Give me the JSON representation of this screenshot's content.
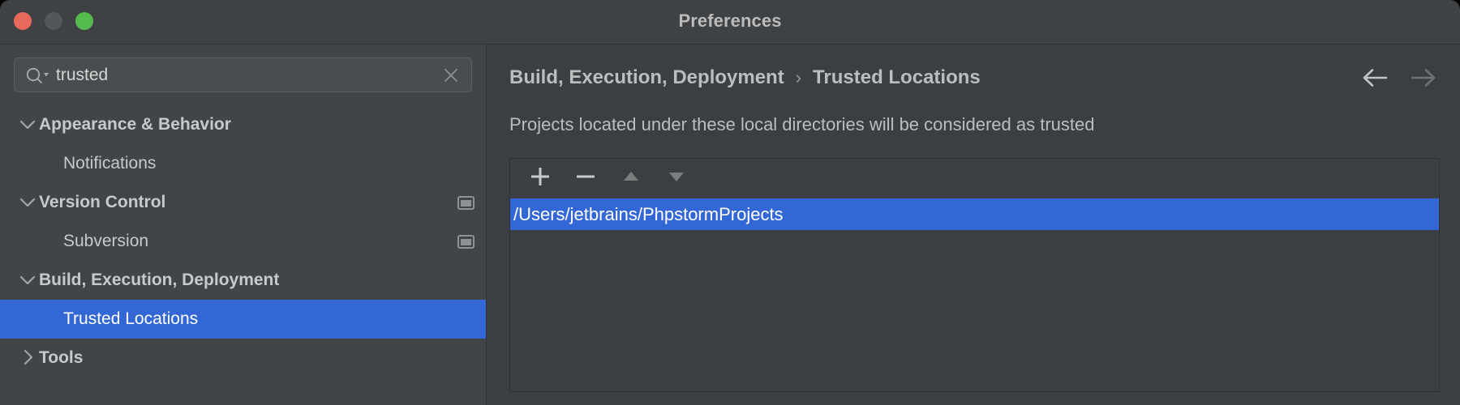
{
  "window": {
    "title": "Preferences",
    "controls": [
      {
        "name": "close",
        "color": "#e8695c"
      },
      {
        "name": "minimize",
        "color": "#53565a"
      },
      {
        "name": "zoom",
        "color": "#54bb4e"
      }
    ]
  },
  "search": {
    "value": "trusted",
    "placeholder": "Search",
    "search_icon": "search-icon",
    "clear_icon": "close-icon"
  },
  "sidebar": {
    "items": [
      {
        "label": "Appearance & Behavior",
        "type": "group",
        "expanded": true,
        "chevron": "chevron-down-icon",
        "selected": false,
        "badge": false
      },
      {
        "label": "Notifications",
        "type": "child",
        "selected": false,
        "badge": false
      },
      {
        "label": "Version Control",
        "type": "group",
        "expanded": true,
        "chevron": "chevron-down-icon",
        "selected": false,
        "badge": true
      },
      {
        "label": "Subversion",
        "type": "child",
        "selected": false,
        "badge": true
      },
      {
        "label": "Build, Execution, Deployment",
        "type": "group",
        "expanded": true,
        "chevron": "chevron-down-icon",
        "selected": false,
        "badge": false
      },
      {
        "label": "Trusted Locations",
        "type": "child",
        "selected": true,
        "badge": false
      },
      {
        "label": "Tools",
        "type": "group",
        "expanded": false,
        "chevron": "chevron-right-icon",
        "selected": false,
        "badge": false
      }
    ]
  },
  "main": {
    "breadcrumb": {
      "parent": "Build, Execution, Deployment",
      "separator": "›",
      "current": "Trusted Locations"
    },
    "nav": {
      "back_icon": "arrow-left-icon",
      "forward_icon": "arrow-right-icon"
    },
    "description": "Projects located under these local directories will be considered as trusted",
    "toolbar": [
      {
        "name": "add-button",
        "icon": "plus-icon",
        "enabled": true
      },
      {
        "name": "remove-button",
        "icon": "minus-icon",
        "enabled": true
      },
      {
        "name": "move-up-button",
        "icon": "triangle-up-icon",
        "enabled": false
      },
      {
        "name": "move-down-button",
        "icon": "triangle-down-icon",
        "enabled": false
      }
    ],
    "locations": [
      {
        "path": "/Users/jetbrains/PhpstormProjects",
        "selected": true
      }
    ]
  },
  "colors": {
    "accent": "#3367d6",
    "window_bg": "#3c3f41",
    "sidebar_bg": "#414547",
    "titlebar_bg": "#3f4245",
    "text": "#bcbdbe"
  }
}
